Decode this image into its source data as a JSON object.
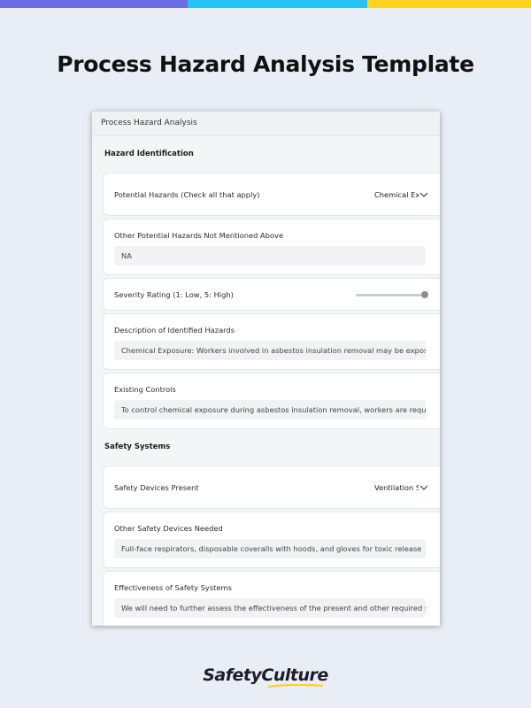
{
  "colors": {
    "bar_purple": "#6c6ee6",
    "bar_cyan": "#27c3f4",
    "bar_yellow": "#ffd21f",
    "background": "#e9edf5",
    "brand_underline": "#ffd21f"
  },
  "page": {
    "title": "Process Hazard Analysis Template"
  },
  "form": {
    "header": "Process Hazard Analysis",
    "sections": {
      "hazard": {
        "title": "Hazard Identification",
        "potential_hazards": {
          "label": "Potential Hazards (Check all that apply)",
          "value": "Chemical Exposure"
        },
        "other_hazards": {
          "label": "Other Potential Hazards Not Mentioned Above",
          "value": "NA"
        },
        "severity": {
          "label": "Severity Rating (1: Low, 5: High)",
          "value": 5,
          "min": 1,
          "max": 5
        },
        "description": {
          "label": "Description of Identified Hazards",
          "value": "Chemical Exposure: Workers involved in asbestos insulation removal may be exposed to hazardous asbestos fibers"
        },
        "existing_controls": {
          "label": "Existing Controls",
          "value": "To control chemical exposure during asbestos insulation removal, workers are required to wear respirators"
        }
      },
      "safety": {
        "title": "Safety Systems",
        "devices_present": {
          "label": "Safety Devices Present",
          "value": "Ventilation Systems"
        },
        "devices_needed": {
          "label": "Other Safety Devices Needed",
          "value": "Full-face respirators, disposable coveralls with hoods, and gloves for toxic release"
        },
        "effectiveness": {
          "label": "Effectiveness of Safety Systems",
          "value": "We will need to further assess the effectiveness of the present and other required safety devices"
        }
      }
    }
  },
  "brand": {
    "name": "SafetyCulture"
  }
}
